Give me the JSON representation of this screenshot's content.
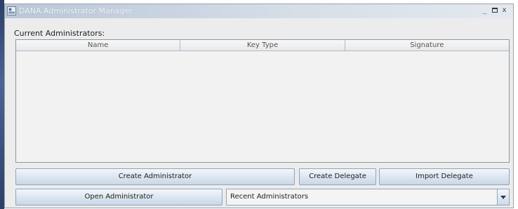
{
  "window": {
    "title": "DANA Administrator Manager",
    "controls": {
      "minimize": "_",
      "close": "x"
    }
  },
  "admins_section": {
    "label": "Current Administrators:",
    "columns": [
      "Name",
      "Key Type",
      "Signature"
    ],
    "rows": []
  },
  "buttons": {
    "create_admin": "Create Administrator",
    "create_delegate": "Create Delegate",
    "import_delegate": "Import Delegate",
    "open_admin": "Open Administrator"
  },
  "recent_admins": {
    "selected": "Recent Administrators"
  },
  "colors": {
    "window_bg": "#ececec",
    "titlebar": "#c9d4e1",
    "button": "#dfe8f2",
    "table_border": "#8d96a0"
  },
  "icons": [
    "app-icon",
    "minimize-icon",
    "maximize-icon",
    "close-icon",
    "chevron-down-icon"
  ]
}
